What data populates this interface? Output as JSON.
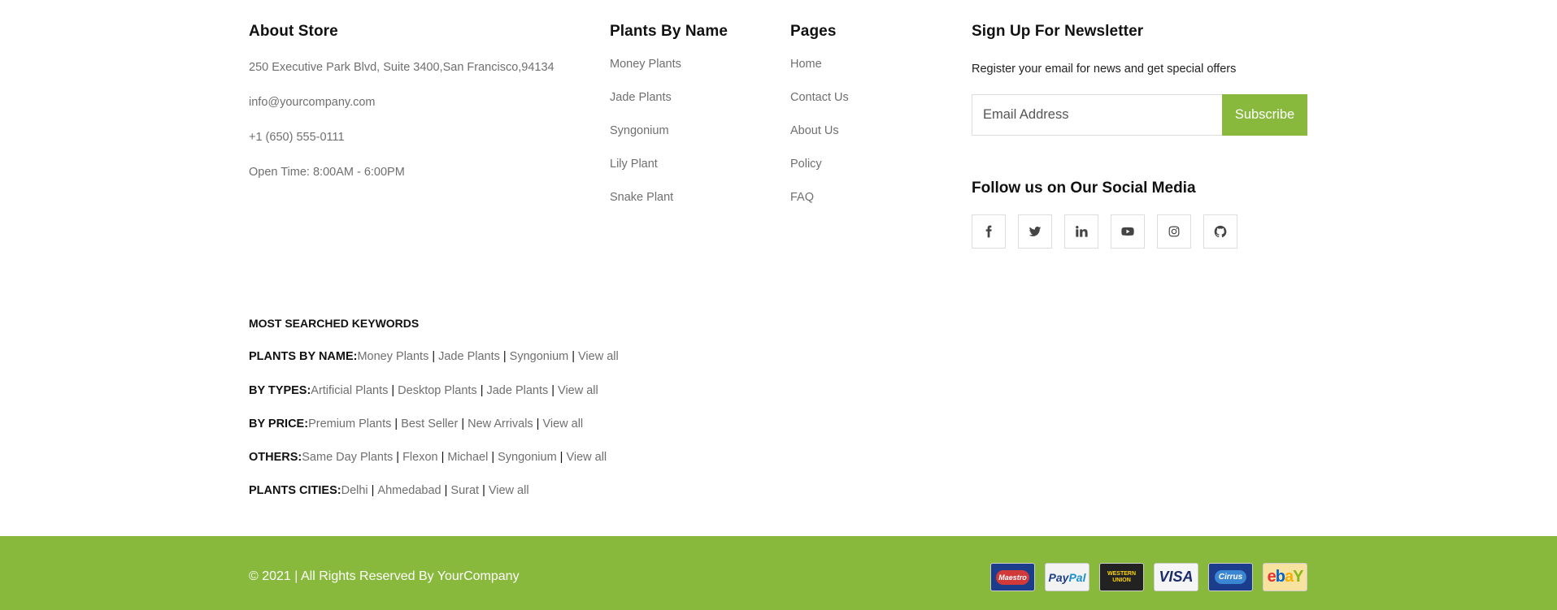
{
  "about": {
    "heading": "About Store",
    "address": "250 Executive Park Blvd, Suite 3400,San Francisco,94134",
    "email": "info@yourcompany.com",
    "phone": "+1 (650) 555-0111",
    "hours": "Open Time: 8:00AM - 6:00PM"
  },
  "plants_by_name": {
    "heading": "Plants By Name",
    "items": [
      "Money Plants",
      "Jade Plants",
      "Syngonium",
      "Lily Plant",
      "Snake Plant"
    ]
  },
  "pages": {
    "heading": "Pages",
    "items": [
      "Home",
      "Contact Us",
      "About Us",
      "Policy",
      "FAQ"
    ]
  },
  "newsletter": {
    "heading": "Sign Up For Newsletter",
    "description": "Register your email for news and get special offers",
    "input_placeholder": "Email Address",
    "button_label": "Subscribe",
    "social_heading": "Follow us on Our Social Media",
    "social_icons": [
      "facebook-icon",
      "twitter-icon",
      "linkedin-icon",
      "youtube-icon",
      "instagram-icon",
      "github-icon"
    ]
  },
  "keywords": {
    "title": "MOST SEARCHED KEYWORDS",
    "rows": [
      {
        "label": "PLANTS BY NAME:",
        "links": [
          "Money Plants",
          "Jade Plants",
          "Syngonium",
          "View all"
        ]
      },
      {
        "label": "BY TYPES:",
        "links": [
          "Artificial Plants",
          "Desktop Plants",
          "Jade Plants",
          "View all"
        ]
      },
      {
        "label": "BY PRICE:",
        "links": [
          "Premium Plants",
          "Best Seller",
          "New Arrivals",
          "View all"
        ]
      },
      {
        "label": "OTHERS:",
        "links": [
          "Same Day Plants",
          "Flexon",
          "Michael",
          "Syngonium",
          "View all"
        ]
      },
      {
        "label": "PLANTS CITIES:",
        "links": [
          "Delhi",
          "Ahmedabad",
          "Surat",
          "View all"
        ]
      }
    ],
    "separator": "|"
  },
  "footer": {
    "copyright": "© 2021 | All Rights Reserved By YourCompany",
    "background_color": "#88b83c",
    "payment_methods": [
      "Maestro",
      "PayPal",
      "Western Union",
      "VISA",
      "Cirrus",
      "ebay"
    ],
    "payment_labels": {
      "maestro": "Maestro",
      "paypal_pay": "Pay",
      "paypal_pal": "Pal",
      "western_1": "WESTERN",
      "western_2": "UNION",
      "visa": "VISA",
      "cirrus": "Cirrus",
      "ebay_e": "e",
      "ebay_b": "b",
      "ebay_a": "a",
      "ebay_y": "Y"
    }
  }
}
